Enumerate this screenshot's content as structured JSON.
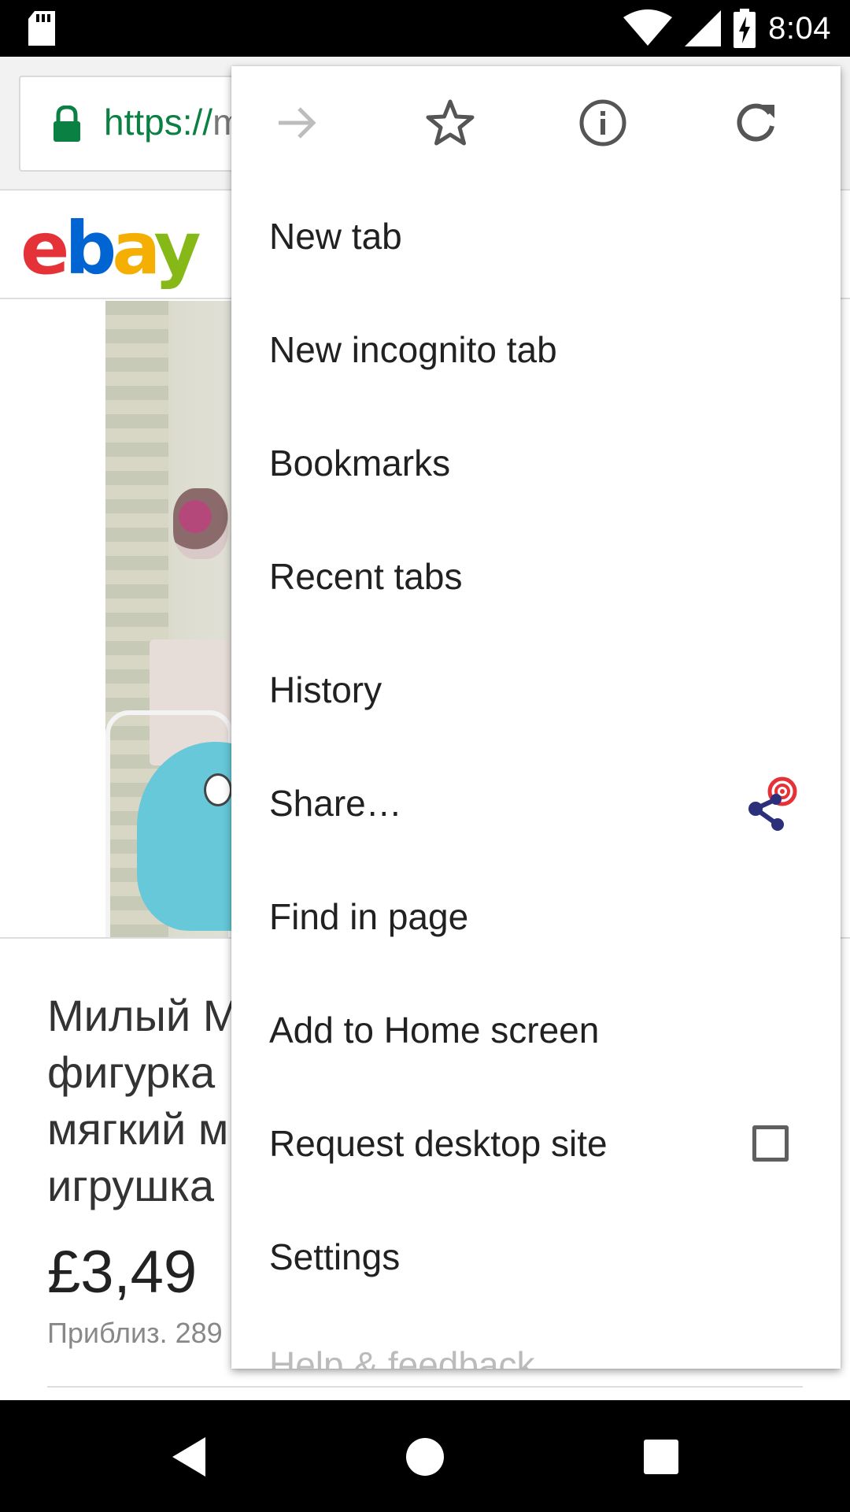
{
  "status_bar": {
    "time": "8:04",
    "icons": [
      "sd-card-icon",
      "wifi-icon",
      "signal-icon",
      "battery-charging-icon"
    ]
  },
  "toolbar": {
    "url_scheme": "https://",
    "url_rest": "m",
    "secure_icon": "lock-icon"
  },
  "page": {
    "logo_letters": [
      "e",
      "b",
      "a",
      "y"
    ],
    "product_title": "Милый M... фигурка... мягкий м... игрушка...",
    "product_title_lines": [
      "Милый M",
      "фигурка",
      "мягкий м",
      "игрушка"
    ],
    "price": "£3,49",
    "price_approx": "Приблиз. 289"
  },
  "menu": {
    "top_icons": [
      "forward-arrow-icon",
      "bookmark-star-icon",
      "page-info-icon",
      "reload-icon"
    ],
    "items": [
      {
        "label": "New tab"
      },
      {
        "label": "New incognito tab"
      },
      {
        "label": "Bookmarks"
      },
      {
        "label": "Recent tabs"
      },
      {
        "label": "History"
      },
      {
        "label": "Share…",
        "badge": "share-target-icon"
      },
      {
        "label": "Find in page"
      },
      {
        "label": "Add to Home screen"
      },
      {
        "label": "Request desktop site",
        "checked": false
      },
      {
        "label": "Settings"
      },
      {
        "label": "Help & feedback"
      }
    ]
  },
  "nav_bar": {
    "icons": [
      "back-icon",
      "home-icon",
      "recents-icon"
    ]
  },
  "colors": {
    "url_green": "#0b8043",
    "share_blue": "#2c2f7a",
    "share_red": "#e53238"
  }
}
